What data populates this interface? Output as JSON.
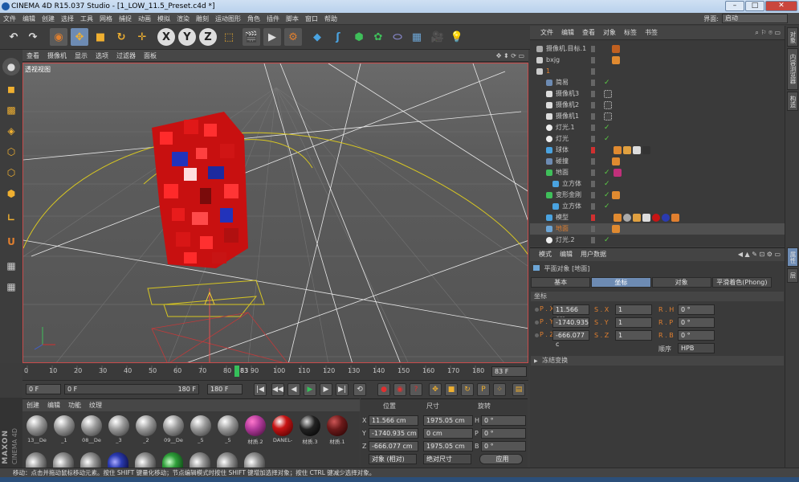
{
  "window": {
    "title": "CINEMA 4D R15.037 Studio - [1_LOW_11.5_Preset.c4d *]",
    "minimize": "–",
    "maximize": "□",
    "close": "✕"
  },
  "menubar": [
    "文件",
    "编辑",
    "创建",
    "选择",
    "工具",
    "网格",
    "捕捉",
    "动画",
    "模拟",
    "渲染",
    "雕刻",
    "运动图形",
    "角色",
    "插件",
    "脚本",
    "窗口",
    "帮助"
  ],
  "layout": {
    "label": "界面:",
    "value": "启动"
  },
  "viewport": {
    "menu": [
      "查看",
      "摄像机",
      "显示",
      "选项",
      "过滤器",
      "面板"
    ],
    "label": "透视视图"
  },
  "timeline": {
    "ticks": [
      "0",
      "10",
      "20",
      "30",
      "40",
      "50",
      "60",
      "70",
      "80",
      "90",
      "100",
      "110",
      "120",
      "130",
      "140",
      "150",
      "160",
      "170",
      "180"
    ],
    "current_frame": "83",
    "frame_box": "83 F"
  },
  "playback": {
    "start": "0 F",
    "range_start": "0 F",
    "range_end": "180 F",
    "end": "180 F"
  },
  "materials": {
    "menu": [
      "创建",
      "编辑",
      "功能",
      "纹理"
    ],
    "items": [
      {
        "label": "13__De",
        "color": "#9a9a9a"
      },
      {
        "label": "_1",
        "color": "#9a9a9a"
      },
      {
        "label": "08__De",
        "color": "#9a9a9a"
      },
      {
        "label": "_3",
        "color": "#9a9a9a"
      },
      {
        "label": "_2",
        "color": "#9a9a9a"
      },
      {
        "label": "09__De",
        "color": "#9a9a9a"
      },
      {
        "label": "_5",
        "color": "#9a9a9a"
      },
      {
        "label": "_5",
        "color": "#9a9a9a"
      },
      {
        "label": "材质.2",
        "color": "#b13a9a"
      },
      {
        "label": "DANEL-",
        "color": "#c81414"
      },
      {
        "label": "材质.3",
        "color": "#222222"
      },
      {
        "label": "材质.1",
        "color": "#6b1a1a"
      }
    ]
  },
  "coords": {
    "headers": [
      "位置",
      "尺寸",
      "旋转"
    ],
    "rows": [
      {
        "axis": "X",
        "pos": "11.566 cm",
        "size": "1975.05 cm",
        "rot_axis": "H",
        "rot": "0 °"
      },
      {
        "axis": "Y",
        "pos": "-1740.935 cm",
        "size": "0 cm",
        "rot_axis": "P",
        "rot": "0 °"
      },
      {
        "axis": "Z",
        "pos": "-666.077 cm",
        "size": "1975.05 cm",
        "rot_axis": "B",
        "rot": "0 °"
      }
    ],
    "mode": "对象 (相对)",
    "size_mode": "绝对尺寸",
    "apply": "应用"
  },
  "objects": {
    "menu": [
      "文件",
      "编辑",
      "查看",
      "对象",
      "标签",
      "书签"
    ],
    "items": [
      {
        "name": "摄像机.目标.1",
        "indent": 0,
        "color": "#bbbbbb"
      },
      {
        "name": "bxjg",
        "indent": 0,
        "color": "#bbbbbb"
      },
      {
        "name": "1",
        "indent": 0,
        "color": "#e07f2f"
      },
      {
        "name": "简易",
        "indent": 1,
        "color": "#bbbbbb"
      },
      {
        "name": "摄像机3",
        "indent": 1,
        "color": "#bbbbbb"
      },
      {
        "name": "摄像机2",
        "indent": 1,
        "color": "#bbbbbb"
      },
      {
        "name": "摄像机1",
        "indent": 1,
        "color": "#bbbbbb"
      },
      {
        "name": "灯光.1",
        "indent": 1,
        "color": "#bbbbbb"
      },
      {
        "name": "灯光",
        "indent": 1,
        "color": "#bbbbbb"
      },
      {
        "name": "球体",
        "indent": 1,
        "color": "#bbbbbb"
      },
      {
        "name": "碰撞",
        "indent": 1,
        "color": "#bbbbbb"
      },
      {
        "name": "地面",
        "indent": 1,
        "color": "#bbbbbb"
      },
      {
        "name": "立方体",
        "indent": 2,
        "color": "#bbbbbb"
      },
      {
        "name": "变形金刚",
        "indent": 1,
        "color": "#bbbbbb"
      },
      {
        "name": "立方体",
        "indent": 2,
        "color": "#bbbbbb"
      },
      {
        "name": "模型",
        "indent": 1,
        "color": "#bbbbbb"
      },
      {
        "name": "地面",
        "indent": 1,
        "color": "#e07f2f"
      },
      {
        "name": "灯光.2",
        "indent": 1,
        "color": "#bbbbbb"
      }
    ]
  },
  "attributes": {
    "menu": [
      "模式",
      "编辑",
      "用户数据"
    ],
    "object_label": "平面对象 [地面]",
    "tabs": [
      "基本",
      "坐标",
      "对象",
      "平滑着色(Phong)"
    ],
    "active_tab": "坐标",
    "section": "坐标",
    "fields": [
      {
        "label": "P . X",
        "value": "11.566 cm",
        "label2": "S . X",
        "value2": "1",
        "label3": "R . H",
        "value3": "0 °"
      },
      {
        "label": "P . Y",
        "value": "-1740.935",
        "label2": "S . Y",
        "value2": "1",
        "label3": "R . P",
        "value3": "0 °"
      },
      {
        "label": "P . Z",
        "value": "-666.077 c",
        "label2": "S . Z",
        "value2": "1",
        "label3": "R . B",
        "value3": "0 °"
      }
    ],
    "order_label": "顺序",
    "order_value": "HPB",
    "freeze": "冻结变换"
  },
  "sidebar_tabs": [
    "对象",
    "内容浏览器",
    "构造",
    "属性",
    "层"
  ],
  "status": "移动：点击并拖动鼠标移动元素。按住 SHIFT 键量化移动；节点编辑模式时按住 SHIFT 键增加选择对象；按住 CTRL 键减少选择对象。",
  "maxon": {
    "brand": "MAXON",
    "product": "CINEMA 4D"
  }
}
